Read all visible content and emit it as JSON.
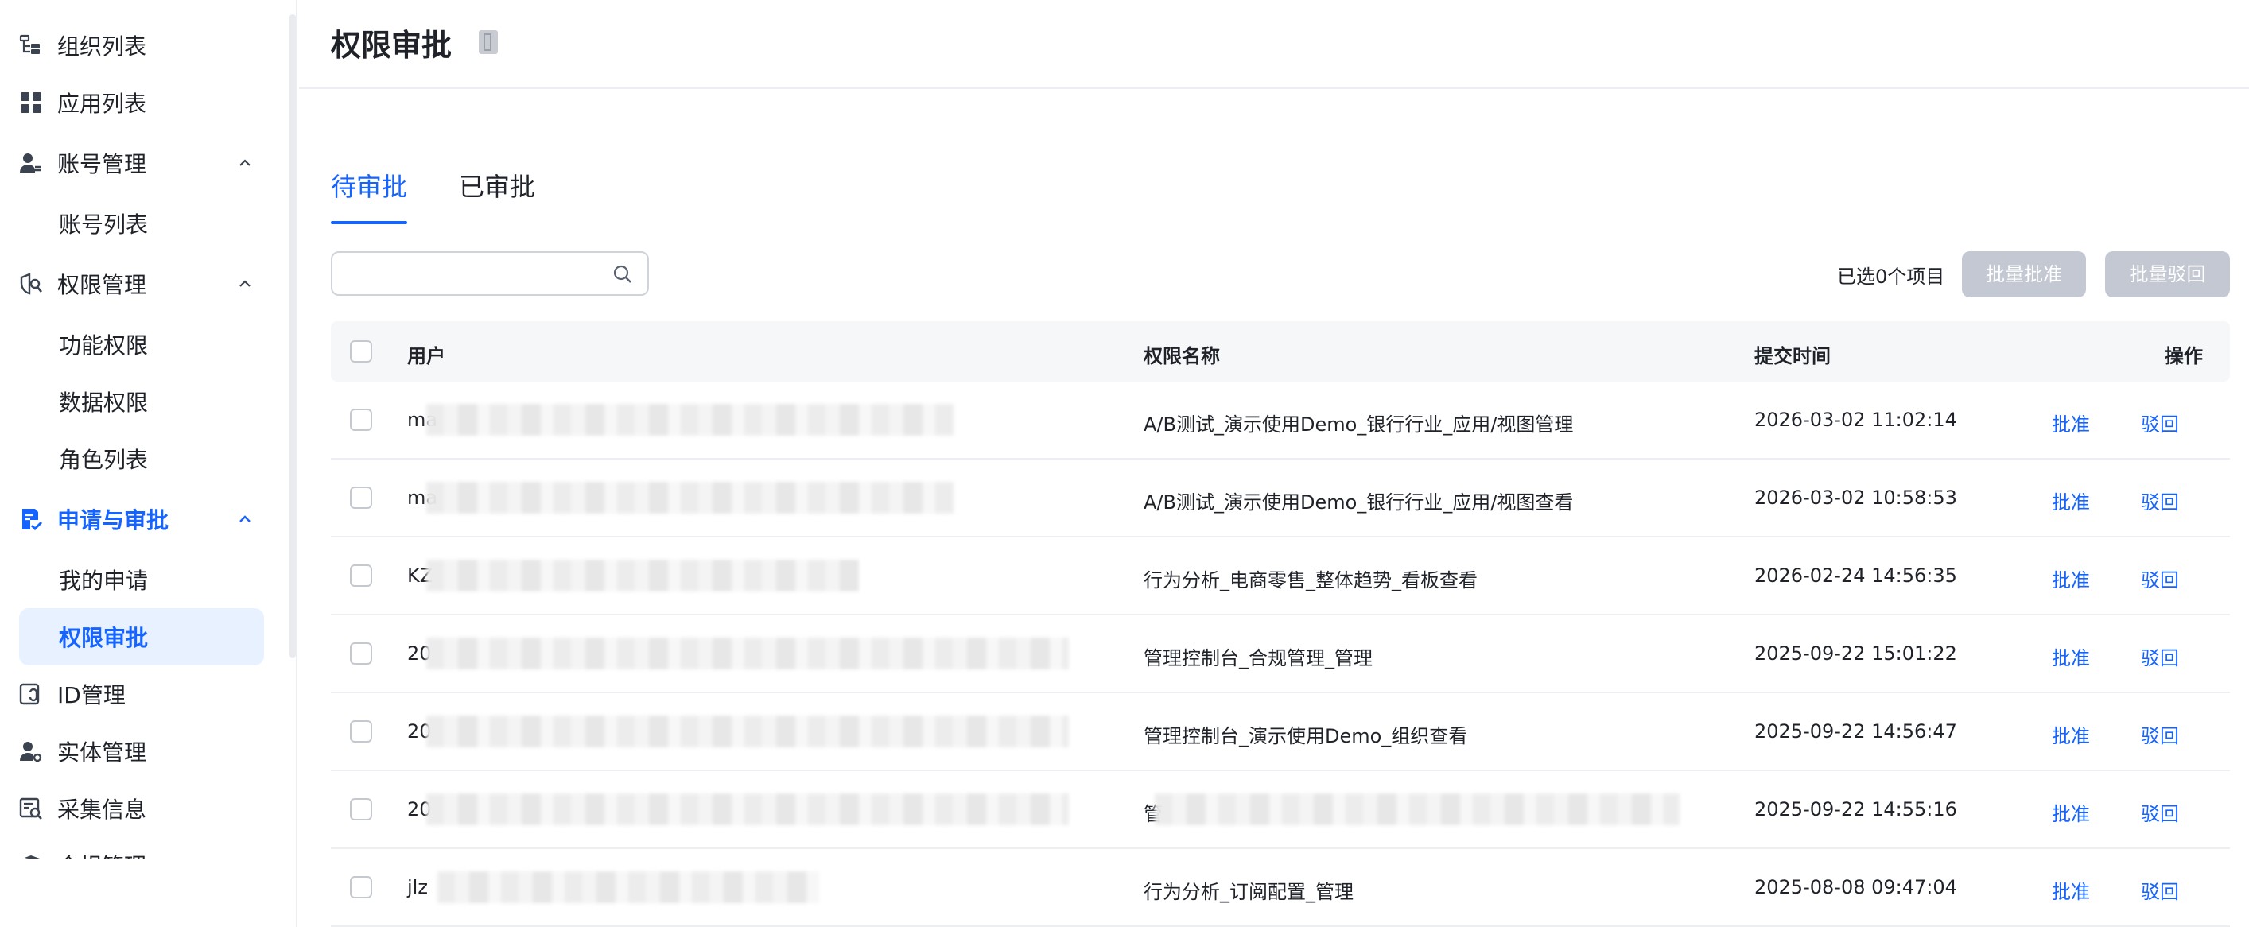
{
  "sidebar": {
    "items": [
      {
        "label": "组织列表"
      },
      {
        "label": "应用列表"
      },
      {
        "label": "账号管理"
      },
      {
        "label": "账号列表"
      },
      {
        "label": "权限管理"
      },
      {
        "label": "功能权限"
      },
      {
        "label": "数据权限"
      },
      {
        "label": "角色列表"
      },
      {
        "label": "申请与审批"
      },
      {
        "label": "我的申请"
      },
      {
        "label": "权限审批"
      },
      {
        "label": "ID管理"
      },
      {
        "label": "实体管理"
      },
      {
        "label": "采集信息"
      },
      {
        "label": "合规管理"
      }
    ]
  },
  "header": {
    "title": "权限审批"
  },
  "tabs": [
    {
      "label": "待审批",
      "active": true
    },
    {
      "label": "已审批",
      "active": false
    }
  ],
  "toolbar": {
    "search_value": "",
    "selected_text": "已选0个项目",
    "batch_approve": "批量批准",
    "batch_reject": "批量驳回"
  },
  "table": {
    "columns": {
      "user": "用户",
      "permission": "权限名称",
      "time": "提交时间",
      "action": "操作"
    },
    "action_labels": {
      "approve": "批准",
      "reject": "驳回"
    },
    "rows": [
      {
        "user": "ma",
        "permission": "A/B测试_演示使用Demo_银行行业_应用/视图管理",
        "time": "2026-03-02 11:02:14"
      },
      {
        "user": "ma",
        "permission": "A/B测试_演示使用Demo_银行行业_应用/视图查看",
        "time": "2026-03-02 10:58:53"
      },
      {
        "user": "KZ",
        "permission": "行为分析_电商零售_整体趋势_看板查看",
        "time": "2026-02-24 14:56:35"
      },
      {
        "user": "20",
        "permission": "管理控制台_合规管理_管理",
        "time": "2025-09-22 15:01:22"
      },
      {
        "user": "20",
        "permission": "管理控制台_演示使用Demo_组织查看",
        "time": "2025-09-22 14:56:47"
      },
      {
        "user": "20",
        "permission": "管",
        "time": "2025-09-22 14:55:16"
      },
      {
        "user": "jlz",
        "permission": "行为分析_订阅配置_管理",
        "time": "2025-08-08 09:47:04"
      }
    ]
  },
  "colors": {
    "accent": "#1664ff",
    "disabled_button": "#c3c8d2",
    "selected_bg": "#e8f1ff"
  }
}
